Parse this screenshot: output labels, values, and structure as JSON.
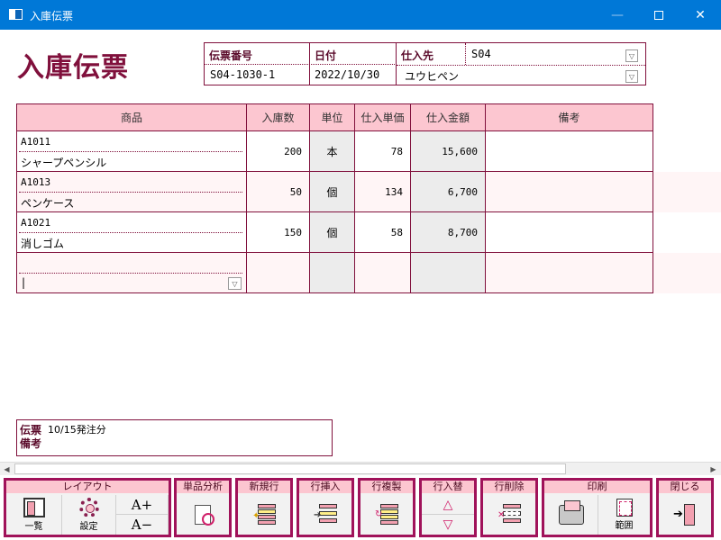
{
  "window": {
    "title": "入庫伝票"
  },
  "form_title": "入庫伝票",
  "header": {
    "voucher_no_label": "伝票番号",
    "voucher_no": "S04-1030-1",
    "date_label": "日付",
    "date": "2022/10/30",
    "supplier_label": "仕入先",
    "supplier_code": "S04",
    "supplier_name": "ユウヒペン"
  },
  "table": {
    "headers": [
      "商品",
      "入庫数",
      "単位",
      "仕入単価",
      "仕入金額",
      "備考"
    ],
    "rows": [
      {
        "code": "A1011",
        "name": "シャープペンシル",
        "qty": "200",
        "unit": "本",
        "price": "78",
        "amount": "15,600",
        "note": ""
      },
      {
        "code": "A1013",
        "name": "ペンケース",
        "qty": "50",
        "unit": "個",
        "price": "134",
        "amount": "6,700",
        "note": ""
      },
      {
        "code": "A1021",
        "name": "消しゴム",
        "qty": "150",
        "unit": "個",
        "price": "58",
        "amount": "8,700",
        "note": ""
      },
      {
        "code": "",
        "name": "",
        "qty": "",
        "unit": "",
        "price": "",
        "amount": "",
        "note": ""
      }
    ]
  },
  "memo": {
    "label": "伝票備考",
    "value": "10/15発注分"
  },
  "toolbar": {
    "layout": {
      "label": "レイアウト",
      "list": "一覧",
      "settings": "設定",
      "font_up": "A+",
      "font_down": "A−"
    },
    "analysis": {
      "label": "単品分析"
    },
    "new_row": {
      "label": "新規行"
    },
    "insert_row": {
      "label": "行挿入"
    },
    "copy_row": {
      "label": "行複製"
    },
    "swap_row": {
      "label": "行入替"
    },
    "delete_row": {
      "label": "行削除"
    },
    "print": {
      "label": "印刷",
      "range": "範囲"
    },
    "close": {
      "label": "閉じる"
    }
  }
}
